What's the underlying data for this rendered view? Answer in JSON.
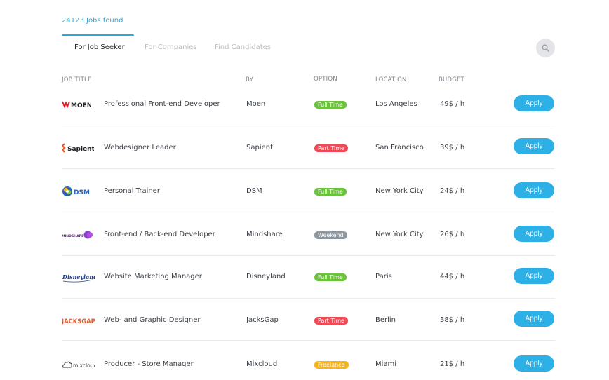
{
  "header": {
    "jobs_found": "24123 Jobs found",
    "tabs": [
      {
        "label": "For Job Seeker",
        "active": true
      },
      {
        "label": "For Companies",
        "active": false
      },
      {
        "label": "Find Candidates",
        "active": false
      }
    ],
    "search_icon": "search-icon"
  },
  "table": {
    "columns": [
      "JOB TITLE",
      "BY",
      "OPTION",
      "LOCATION",
      "BUDGET"
    ],
    "apply_label": "Apply",
    "rows": [
      {
        "logo": "MOEN",
        "title": "Professional Front-end Developer",
        "by": "Moen",
        "option": "Full Time",
        "option_color": "#6bc33b",
        "location": "Los Angeles",
        "budget": "49$ / h"
      },
      {
        "logo": "Sapient",
        "title": "Webdesigner Leader",
        "by": "Sapient",
        "option": "Part Time",
        "option_color": "#ef4a55",
        "location": "San Francisco",
        "budget": "39$ / h"
      },
      {
        "logo": "DSM",
        "title": "Personal Trainer",
        "by": "DSM",
        "option": "Full Time",
        "option_color": "#6bc33b",
        "location": "New York City",
        "budget": "24$ / h"
      },
      {
        "logo": "MINDSHARE",
        "title": "Front-end / Back-end Developer",
        "by": "Mindshare",
        "option": "Weekend",
        "option_color": "#8f979f",
        "location": "New York City",
        "budget": "26$ / h"
      },
      {
        "logo": "Disneyland",
        "title": "Website Marketing Manager",
        "by": "Disneyland",
        "option": "Full Time",
        "option_color": "#6bc33b",
        "location": "Paris",
        "budget": "44$ / h"
      },
      {
        "logo": "JACKSGAP",
        "title": "Web- and Graphic Designer",
        "by": "JacksGap",
        "option": "Part Time",
        "option_color": "#ef4a55",
        "location": "Berlin",
        "budget": "38$ / h"
      },
      {
        "logo": "mixcloud",
        "title": "Producer - Store Manager",
        "by": "Mixcloud",
        "option": "Freelance",
        "option_color": "#f5b31f",
        "location": "Miami",
        "budget": "21$ / h"
      }
    ]
  },
  "colors": {
    "accent": "#2aa8d6",
    "apply_button": "#2cb0e6"
  }
}
